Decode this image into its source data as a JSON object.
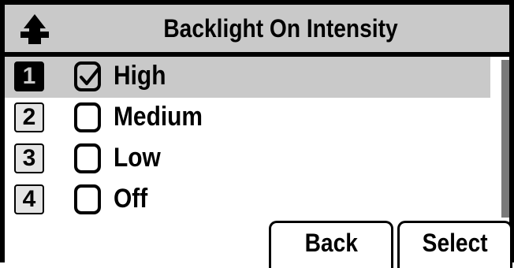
{
  "header": {
    "title": "Backlight On Intensity",
    "icon": "phone-handset-icon"
  },
  "options": [
    {
      "number": "1",
      "label": "High",
      "checked": true,
      "selected": true
    },
    {
      "number": "2",
      "label": "Medium",
      "checked": false,
      "selected": false
    },
    {
      "number": "3",
      "label": "Low",
      "checked": false,
      "selected": false
    },
    {
      "number": "4",
      "label": "Off",
      "checked": false,
      "selected": false
    }
  ],
  "softkeys": {
    "back_label": "Back",
    "select_label": "Select"
  },
  "colors": {
    "highlight": "#c9c9c9",
    "text": "#000000",
    "background": "#ffffff"
  }
}
